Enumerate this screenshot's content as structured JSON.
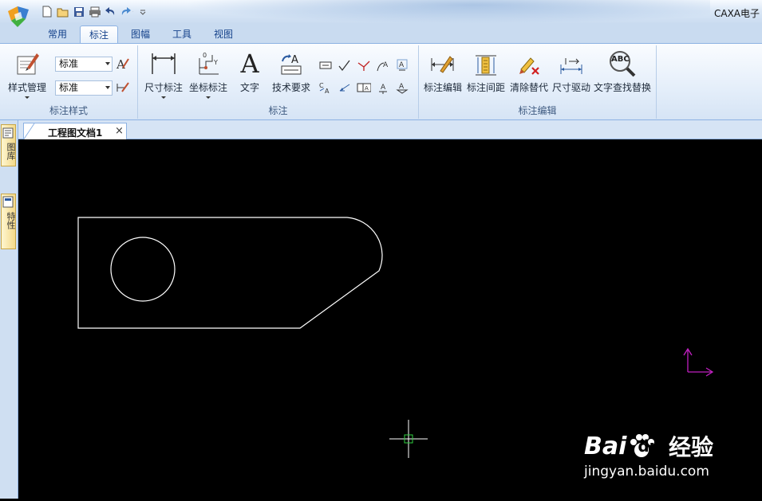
{
  "app": {
    "title": "CAXA电子"
  },
  "quick_access": {
    "icons": [
      "new-file-icon",
      "open-folder-icon",
      "save-icon",
      "print-icon",
      "undo-icon",
      "redo-icon",
      "customize-toolbar-icon"
    ]
  },
  "tabs": [
    {
      "label": "常用",
      "active": false
    },
    {
      "label": "标注",
      "active": true
    },
    {
      "label": "图幅",
      "active": false
    },
    {
      "label": "工具",
      "active": false
    },
    {
      "label": "视图",
      "active": false
    }
  ],
  "ribbon": {
    "style_group": {
      "label": "标注样式",
      "style_manager_label": "样式管理",
      "text_style_value": "标准",
      "dim_style_value": "标准"
    },
    "dimension_group": {
      "label": "标注",
      "dimension_label": "尺寸标注",
      "coordinate_label": "坐标标注",
      "text_label": "文字",
      "text_icon_glyph": "A",
      "tech_req_label": "技术要求"
    },
    "edit_group": {
      "label": "标注编辑",
      "dim_edit_label": "标注编辑",
      "dim_spacing_label": "标注间距",
      "clear_override_label": "清除替代",
      "dim_drive_label": "尺寸驱动",
      "find_replace_label": "文字查找替换",
      "find_replace_icon_text": "ABC"
    }
  },
  "side_panel": {
    "tabs": [
      {
        "label": "图库"
      },
      {
        "label": "特性"
      }
    ]
  },
  "document": {
    "tab_label": "工程图文档1",
    "close_glyph": "×"
  },
  "colors": {
    "canvas": "#000000",
    "geometry": "#ffffff",
    "ucs_axis": "#c020c0",
    "cursor": "#ffffff",
    "cursor_box": "#30d040"
  },
  "watermark": {
    "brand_text": "Bai",
    "brand_suffix": "du",
    "brand_cn": "经验",
    "url": "jingyan.baidu.com"
  }
}
